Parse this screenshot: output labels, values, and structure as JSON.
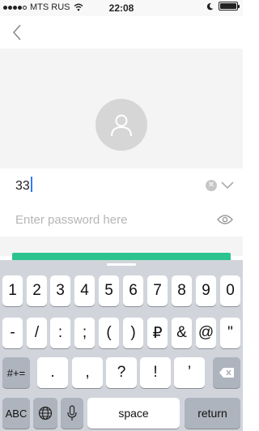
{
  "status_bar": {
    "carrier": "MTS RUS",
    "time": "22:08",
    "signal_bars": 4,
    "battery_level": 1.0
  },
  "phone_field": {
    "value": "33"
  },
  "password_field": {
    "placeholder": "Enter password here",
    "value": ""
  },
  "keyboard": {
    "row1": [
      "1",
      "2",
      "3",
      "4",
      "5",
      "6",
      "7",
      "8",
      "9",
      "0"
    ],
    "row2": [
      "-",
      "/",
      ":",
      ";",
      "(",
      ")",
      "₽",
      "&",
      "@",
      "\""
    ],
    "row3": [
      ".",
      ",",
      "?",
      "!",
      "’"
    ],
    "symbols_key": "#+=",
    "abc_key": "ABC",
    "space_key": "space",
    "return_key": "return"
  },
  "colors": {
    "accent": "#2bc48f",
    "background": "#f4f4f4",
    "keyboard": "#d1d5db"
  },
  "icons": [
    "back-icon",
    "avatar-user-icon",
    "clear-icon",
    "chevron-down-icon",
    "eye-icon",
    "wifi-icon",
    "moon-icon",
    "globe-icon",
    "mic-icon",
    "backspace-icon"
  ]
}
